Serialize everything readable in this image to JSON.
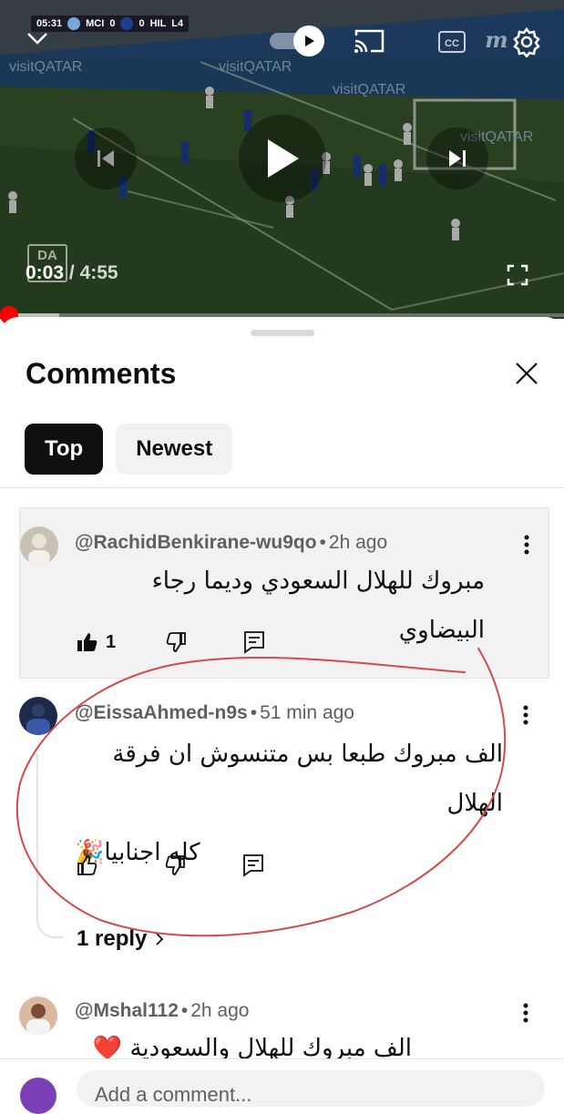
{
  "player": {
    "scorebug": {
      "clock": "05:31",
      "home": "MCI",
      "home_score": "0",
      "away_score": "0",
      "away": "HIL",
      "extra": "L4"
    },
    "ad_text": "visitQATAR",
    "brand_logo": "m",
    "watermark": "DA",
    "current_time": "0:03",
    "separator": "/",
    "duration": "4:55",
    "progress_fraction": 0.011,
    "icons": [
      "chevron-down-icon",
      "autoplay-toggle-icon",
      "cast-icon",
      "captions-icon",
      "settings-icon",
      "previous-icon",
      "play-icon",
      "next-icon",
      "fullscreen-icon"
    ]
  },
  "comments_panel": {
    "title": "Comments",
    "filters": [
      {
        "label": "Top",
        "active": true
      },
      {
        "label": "Newest",
        "active": false
      }
    ],
    "comments": [
      {
        "author": "@RachidBenkirane-wu9qo",
        "time": "2h ago",
        "text_lines": [
          "مبروك للهلال السعودي وديما رجاء البيضاوي"
        ],
        "likes": "1",
        "highlighted": true
      },
      {
        "author": "@EissaAhmed-n9s",
        "time": "51 min ago",
        "text_lines": [
          "الف مبروك طبعا بس متنسوش ان فرقة الهلال",
          "كله اجنابيا🎉"
        ],
        "replies_label": "1 reply",
        "highlighted": false
      },
      {
        "author": "@Mshal112",
        "time": "2h ago",
        "text_lines": [
          "الف مبروك للهلال والسعودية ❤️❤️"
        ],
        "highlighted": false
      }
    ],
    "add_comment_placeholder": "Add a comment..."
  },
  "colors": {
    "accent_red": "#ff0000",
    "chip_active_bg": "#0f0f0f",
    "chip_bg": "#f2f2f2",
    "annotation_circle": "#d24a4a",
    "highlight_bg": "#f2f2f2"
  }
}
